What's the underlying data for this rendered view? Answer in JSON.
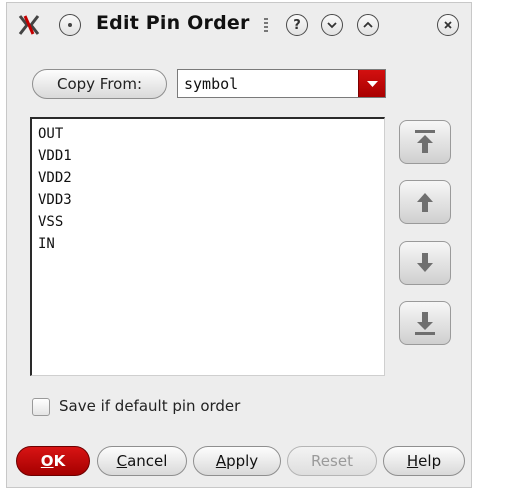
{
  "window": {
    "title": "Edit Pin Order",
    "controls": {
      "help": "?",
      "minimize": "⌄",
      "maximize": "⌃",
      "close": "✕"
    }
  },
  "copy_from": {
    "button_label": "Copy From:",
    "selected": "symbol"
  },
  "pin_list": {
    "items": [
      "OUT",
      "VDD1",
      "VDD2",
      "VDD3",
      "VSS",
      "IN"
    ]
  },
  "move_buttons": [
    {
      "name": "move-to-top",
      "icon": "arrow-to-top-icon"
    },
    {
      "name": "move-up",
      "icon": "arrow-up-icon"
    },
    {
      "name": "move-down",
      "icon": "arrow-down-icon"
    },
    {
      "name": "move-to-bottom",
      "icon": "arrow-to-bottom-icon"
    }
  ],
  "save_default": {
    "label": "Save if default pin order",
    "checked": false
  },
  "buttons": {
    "ok": {
      "mnemonic": "O",
      "rest": "K"
    },
    "cancel": {
      "mnemonic": "C",
      "rest": "ancel"
    },
    "apply": {
      "mnemonic": "A",
      "rest": "pply"
    },
    "reset": {
      "label": "Reset",
      "enabled": false
    },
    "help": {
      "mnemonic": "H",
      "rest": "elp"
    }
  },
  "colors": {
    "accent_red": "#c40000",
    "window_bg": "#ededed"
  }
}
